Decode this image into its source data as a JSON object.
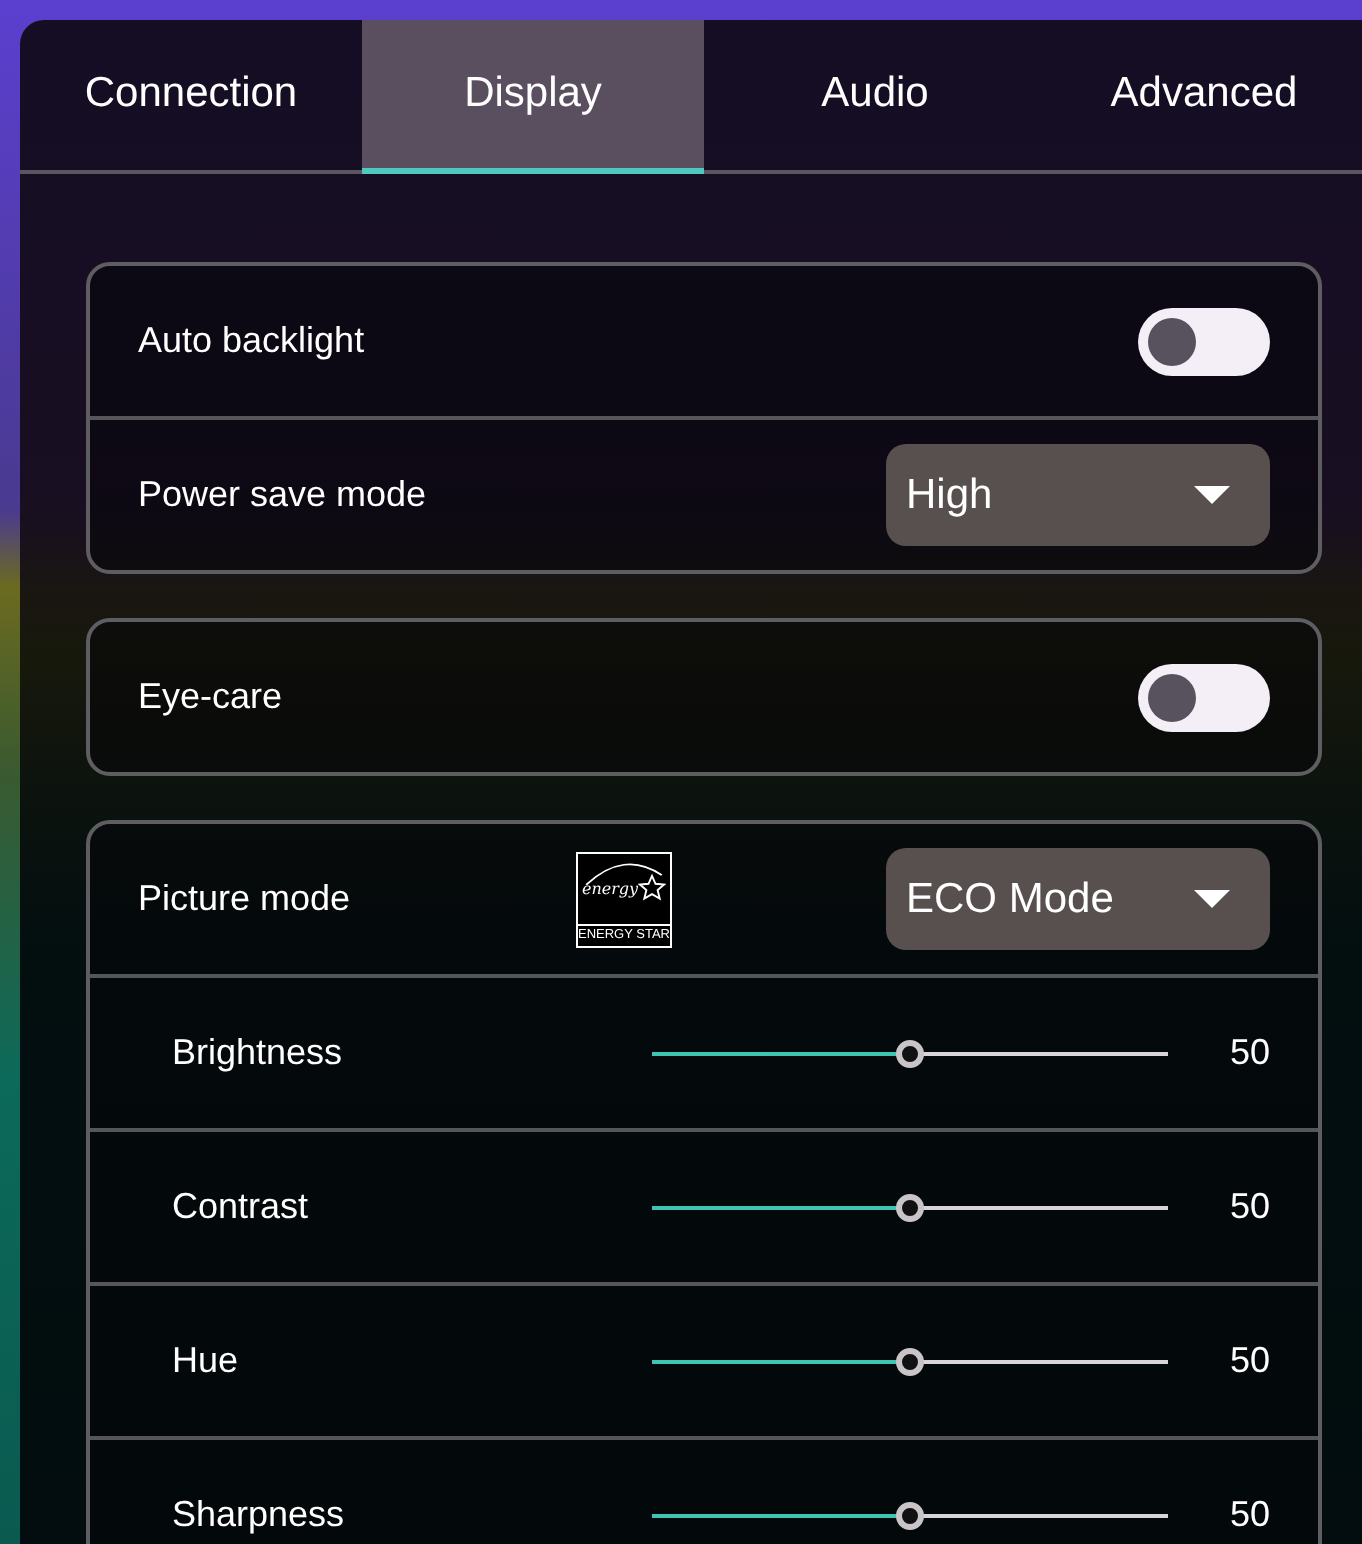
{
  "tabs": [
    {
      "label": "Connection",
      "selected": false
    },
    {
      "label": "Display",
      "selected": true
    },
    {
      "label": "Audio",
      "selected": false
    },
    {
      "label": "Advanced",
      "selected": false
    }
  ],
  "groups": [
    {
      "rows": [
        {
          "kind": "toggle",
          "label": "Auto backlight",
          "on": false
        },
        {
          "kind": "dropdown",
          "label": "Power save mode",
          "value": "High"
        }
      ]
    },
    {
      "rows": [
        {
          "kind": "toggle",
          "label": "Eye-care",
          "on": false
        }
      ]
    },
    {
      "rows": [
        {
          "kind": "dropdown",
          "label": "Picture mode",
          "value": "ECO Mode",
          "logo": {
            "script": "energy",
            "caption": "ENERGY STAR"
          }
        },
        {
          "kind": "slider",
          "label": "Brightness",
          "level": 0.5,
          "reading": "50"
        },
        {
          "kind": "slider",
          "label": "Contrast",
          "level": 0.5,
          "reading": "50"
        },
        {
          "kind": "slider",
          "label": "Hue",
          "level": 0.5,
          "reading": "50"
        },
        {
          "kind": "slider",
          "label": "Sharpness",
          "level": 0.5,
          "reading": "50"
        }
      ]
    }
  ]
}
